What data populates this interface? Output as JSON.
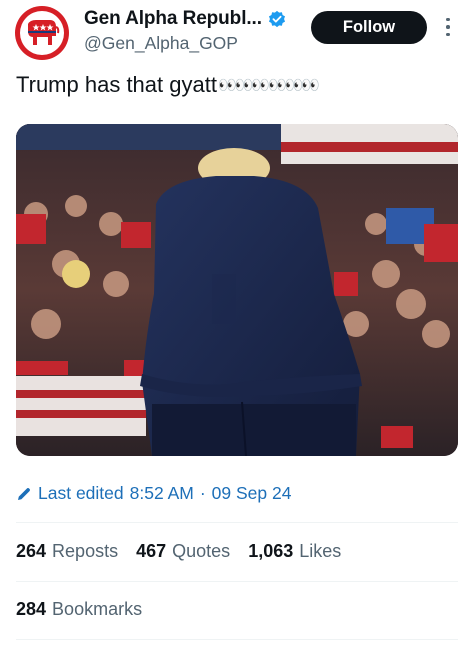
{
  "author": {
    "display_name": "Gen Alpha Republ...",
    "handle": "@Gen_Alpha_GOP",
    "verified": true,
    "avatar_icon": "gop-elephant-icon",
    "avatar_color": "#d61f26"
  },
  "header": {
    "follow_label": "Follow",
    "more_icon": "more-options-icon"
  },
  "tweet": {
    "text": "Trump has that gyatt",
    "emoji": "👀👀👀👀👀👀",
    "media_icon": "photo"
  },
  "meta": {
    "edited_icon": "pencil-icon",
    "edited_label": "Last edited",
    "time": "8:52 AM",
    "separator": "·",
    "date": "09 Sep 24"
  },
  "stats": {
    "reposts": {
      "count": "264",
      "label": "Reposts"
    },
    "quotes": {
      "count": "467",
      "label": "Quotes"
    },
    "likes": {
      "count": "1,063",
      "label": "Likes"
    },
    "bookmarks": {
      "count": "284",
      "label": "Bookmarks"
    }
  },
  "colors": {
    "text": "#0f1419",
    "secondary": "#536471",
    "link": "#1d6fb8",
    "verified": "#1d9bf0",
    "button": "#0f1419"
  }
}
